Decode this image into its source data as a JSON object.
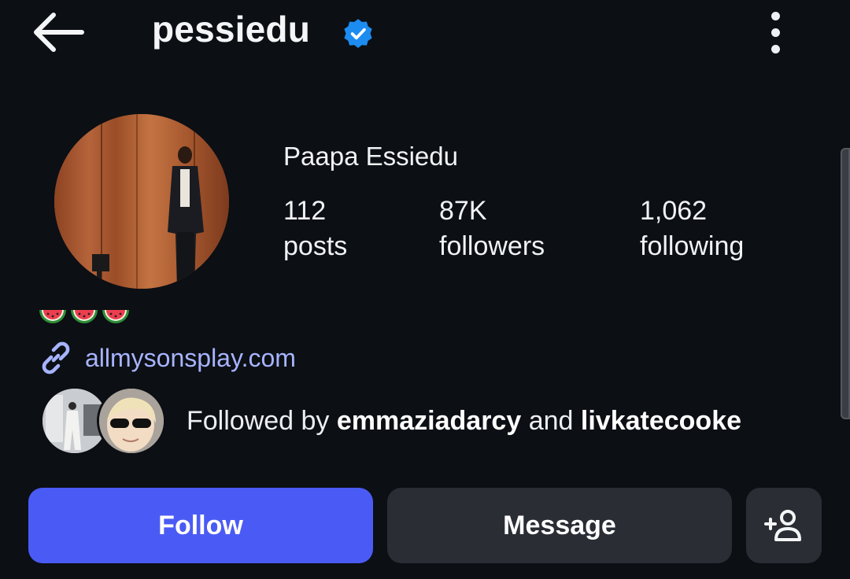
{
  "header": {
    "username": "pessiedu",
    "back_icon": "arrow-left-icon",
    "verified_icon": "verified-badge-icon",
    "more_icon": "more-vertical-icon"
  },
  "profile": {
    "full_name": "Paapa Essiedu",
    "stats": [
      {
        "value": "112",
        "label": "posts"
      },
      {
        "value": "87K",
        "label": "followers"
      },
      {
        "value": "1,062",
        "label": "following"
      }
    ],
    "bio_emoji": "🍉🍉🍉",
    "link": {
      "icon": "link-icon",
      "text": "allmysonsplay.com"
    },
    "followed_by": {
      "prefix": "Followed by",
      "user1": "emmaziadarcy",
      "joiner": "and",
      "user2": "livkatecooke"
    }
  },
  "actions": {
    "follow": "Follow",
    "message": "Message",
    "suggest_icon": "add-person-icon"
  },
  "colors": {
    "background": "#0c0f14",
    "follow_button": "#4a5bf5",
    "secondary_button": "#2a2d34",
    "link": "#a7b4ff",
    "verified": "#1d8cf0"
  }
}
